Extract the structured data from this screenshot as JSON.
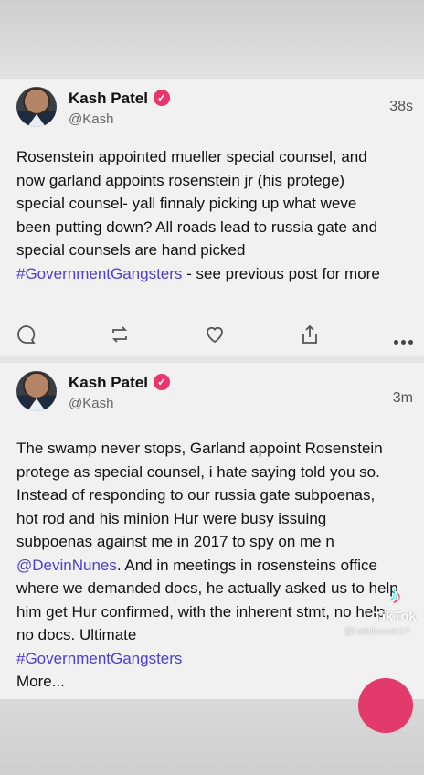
{
  "posts": [
    {
      "author": "Kash Patel",
      "handle": "@Kash",
      "time": "38s",
      "text_before": "Rosenstein appointed mueller special counsel, and now garland appoints rosenstein jr (his protege) special counsel- yall finnaly picking up what weve been putting down? All roads lead to russia gate and special counsels are hand picked ",
      "hashtag": "#GovernmentGangsters",
      "text_after": " - see previous post for more"
    },
    {
      "author": "Kash Patel",
      "handle": "@Kash",
      "time": "3m",
      "text_before": "The swamp never stops, Garland appoint Rosenstein protege as special counsel, i hate saying told you so. Instead of responding to our russia gate subpoenas, hot rod and his minion Hur were busy issuing subpoenas against me in 2017 to spy on me n ",
      "mention": "@DevinNunes",
      "text_after": ". And in meetings in rosensteins office where we demanded docs, he actually asked us to help him get Hur confirmed, with the inherent stmt, no help, no docs. Ultimate",
      "hashtag": "#GovernmentGangsters",
      "more": "More..."
    }
  ],
  "icons": {
    "verified": "verified-badge-icon",
    "reply": "reply-icon",
    "repost": "repost-icon",
    "like": "heart-icon",
    "share": "share-icon",
    "more": "more-dots-icon"
  },
  "watermark": {
    "brand": "TikTok",
    "user": "@kathibonnie17"
  },
  "colors": {
    "hashtag": "#4b3fd1",
    "verified": "#e8356b",
    "fab": "#e23a6a"
  }
}
